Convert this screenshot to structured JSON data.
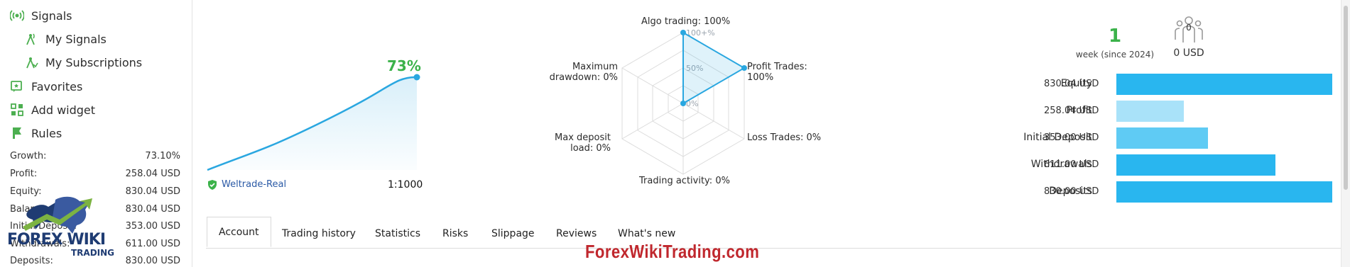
{
  "sidebar": {
    "nav": [
      {
        "label": "Signals",
        "icon": "signal-icon"
      },
      {
        "label": "My Signals",
        "icon": "signal-antenna-icon"
      },
      {
        "label": "My Subscriptions",
        "icon": "subscription-antenna-icon"
      },
      {
        "label": "Favorites",
        "icon": "favorite-icon"
      },
      {
        "label": "Add widget",
        "icon": "widget-icon"
      },
      {
        "label": "Rules",
        "icon": "flag-icon"
      }
    ],
    "stats": [
      {
        "label": "Growth:",
        "value": "73.10%"
      },
      {
        "label": "Profit:",
        "value": "258.04 USD"
      },
      {
        "label": "Equity:",
        "value": "830.04 USD"
      },
      {
        "label": "Balance:",
        "value": "830.04 USD"
      },
      {
        "label": "Initial Deposit:",
        "value": "353.00 USD"
      },
      {
        "label": "Withdrawals:",
        "value": "611.00 USD"
      },
      {
        "label": "Deposits:",
        "value": "830.00 USD"
      }
    ],
    "logo": {
      "line1": "FOREX WIKI",
      "line2": "TRADING"
    }
  },
  "growth_chart": {
    "percent": "73%",
    "broker": "Weltrade-Real",
    "leverage": "1:1000",
    "colors": {
      "line": "#2aa7e0",
      "percent": "#3bb24a"
    }
  },
  "radar": {
    "ticks": [
      "100+%",
      "50%",
      "0%"
    ],
    "axes": [
      {
        "label": "Algo trading: 100%"
      },
      {
        "label": "Profit Trades: 100%"
      },
      {
        "label": "Loss Trades: 0%"
      },
      {
        "label": "Trading activity: 0%"
      },
      {
        "label": "Max deposit load: 0%"
      },
      {
        "label": "Maximum drawdown: 0%"
      }
    ],
    "values": [
      1.0,
      1.0,
      0,
      0,
      0,
      0
    ]
  },
  "summary": {
    "weeks": "1",
    "weeks_label": "week (since 2024)",
    "subscribers": "0",
    "price": "0 USD"
  },
  "chart_data": {
    "type": "bar",
    "categories": [
      "Equity",
      "Profit",
      "Initial Deposit",
      "Withdrawals",
      "Deposits"
    ],
    "display_values": [
      "830.04 USD",
      "258.04 USD",
      "353.00 USD",
      "611.00 USD",
      "830.00 USD"
    ],
    "values": [
      830.04,
      258.04,
      353.0,
      611.0,
      830.0
    ],
    "xlim": [
      0,
      830.04
    ],
    "colors": [
      "#29b6ef",
      "#a9e2f9",
      "#5fcbf4",
      "#29b6ef",
      "#29b6ef"
    ]
  },
  "tabs": [
    {
      "label": "Account",
      "active": true
    },
    {
      "label": "Trading history"
    },
    {
      "label": "Statistics"
    },
    {
      "label": "Risks"
    },
    {
      "label": "Slippage"
    },
    {
      "label": "Reviews"
    },
    {
      "label": "What's new"
    }
  ],
  "watermark": "ForexWikiTrading.com"
}
